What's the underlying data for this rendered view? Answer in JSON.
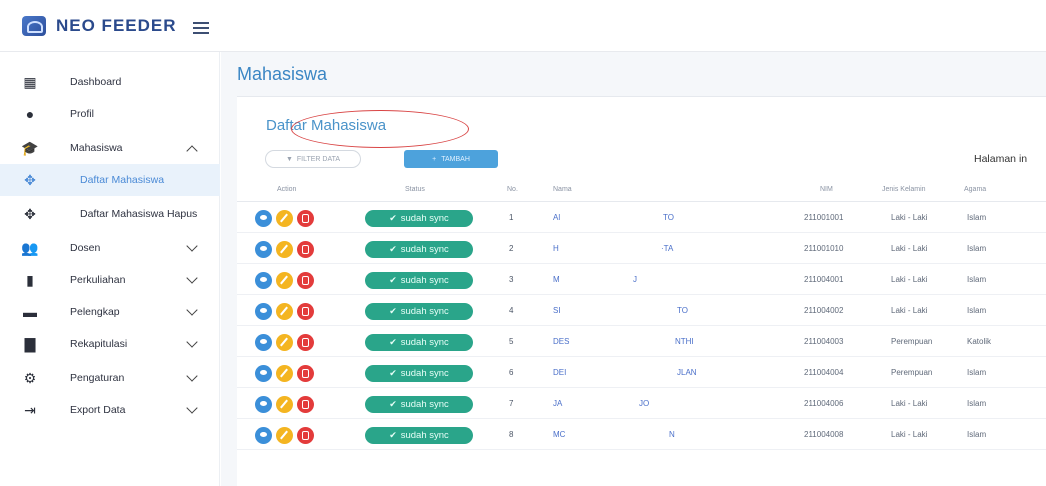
{
  "app": {
    "title": "NEO FEEDER"
  },
  "sidebar": {
    "items": [
      {
        "label": "Dashboard",
        "icon": "dashboard-icon",
        "glyph": "▦"
      },
      {
        "label": "Profil",
        "icon": "user-icon",
        "glyph": "●"
      },
      {
        "label": "Mahasiswa",
        "icon": "graduation-cap-icon",
        "glyph": "🎓"
      },
      {
        "label": "Daftar Mahasiswa",
        "icon": "arrows-icon",
        "glyph": "✥"
      },
      {
        "label": "Daftar Mahasiswa Hapus",
        "icon": "arrows-icon",
        "glyph": "✥"
      },
      {
        "label": "Dosen",
        "icon": "users-icon",
        "glyph": "👥"
      },
      {
        "label": "Perkuliahan",
        "icon": "book-icon",
        "glyph": "▮"
      },
      {
        "label": "Pelengkap",
        "icon": "briefcase-icon",
        "glyph": "▬"
      },
      {
        "label": "Rekapitulasi",
        "icon": "file-icon",
        "glyph": "▇"
      },
      {
        "label": "Pengaturan",
        "icon": "cogs-icon",
        "glyph": "⚙"
      },
      {
        "label": "Export Data",
        "icon": "export-icon",
        "glyph": "⇥"
      }
    ]
  },
  "main": {
    "page_title": "Mahasiswa",
    "card_title": "Daftar Mahasiswa",
    "filter_label": "FILTER DATA",
    "add_label": "TAMBAH",
    "halaman_label": "Halaman in"
  },
  "table": {
    "headers": {
      "action": "Action",
      "status": "Status",
      "no": "No.",
      "nama": "Nama",
      "nim": "NIM",
      "jenis_kelamin": "Jenis Kelamin",
      "agama": "Agama"
    },
    "status_label": "sudah sync",
    "rows": [
      {
        "no": "1",
        "nama1": "Al",
        "nama2": "TO",
        "nim": "211001001",
        "jk": "Laki - Laki",
        "agama": "Islam"
      },
      {
        "no": "2",
        "nama1": "H",
        "nama2": "·TA",
        "nim": "211001010",
        "jk": "Laki - Laki",
        "agama": "Islam"
      },
      {
        "no": "3",
        "nama1": "M",
        "nama2": "J",
        "nim": "211004001",
        "jk": "Laki - Laki",
        "agama": "Islam"
      },
      {
        "no": "4",
        "nama1": "SI",
        "nama2": "TO",
        "nim": "211004002",
        "jk": "Laki - Laki",
        "agama": "Islam"
      },
      {
        "no": "5",
        "nama1": "DES",
        "nama2": "NTHI",
        "nim": "211004003",
        "jk": "Perempuan",
        "agama": "Katolik"
      },
      {
        "no": "6",
        "nama1": "DEI",
        "nama2": "JLAN",
        "nim": "211004004",
        "jk": "Perempuan",
        "agama": "Islam"
      },
      {
        "no": "7",
        "nama1": "JA",
        "nama2": "JO",
        "nim": "211004006",
        "jk": "Laki - Laki",
        "agama": "Islam"
      },
      {
        "no": "8",
        "nama1": "MC",
        "nama2": "N",
        "nim": "211004008",
        "jk": "Laki - Laki",
        "agama": "Islam"
      }
    ]
  }
}
